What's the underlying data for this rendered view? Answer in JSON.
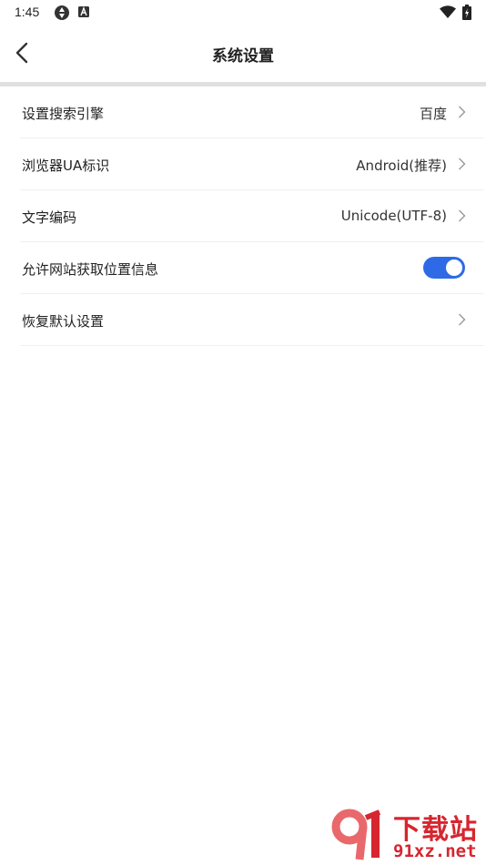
{
  "status_bar": {
    "time": "1:45"
  },
  "header": {
    "title": "系统设置"
  },
  "settings": [
    {
      "label": "设置搜索引擎",
      "value": "百度"
    },
    {
      "label": "浏览器UA标识",
      "value": "Android(推荐)"
    },
    {
      "label": "文字编码",
      "value": "Unicode(UTF-8)"
    },
    {
      "label": "允许网站获取位置信息",
      "toggle_on": true
    },
    {
      "label": "恢复默认设置",
      "value": ""
    }
  ],
  "watermark": {
    "title": "下载站",
    "domain": "91xz.net",
    "logo_text": "91"
  },
  "colors": {
    "toggle_on": "#2f6ae6",
    "divider": "#e0e0e0",
    "watermark": "#d6262f"
  }
}
